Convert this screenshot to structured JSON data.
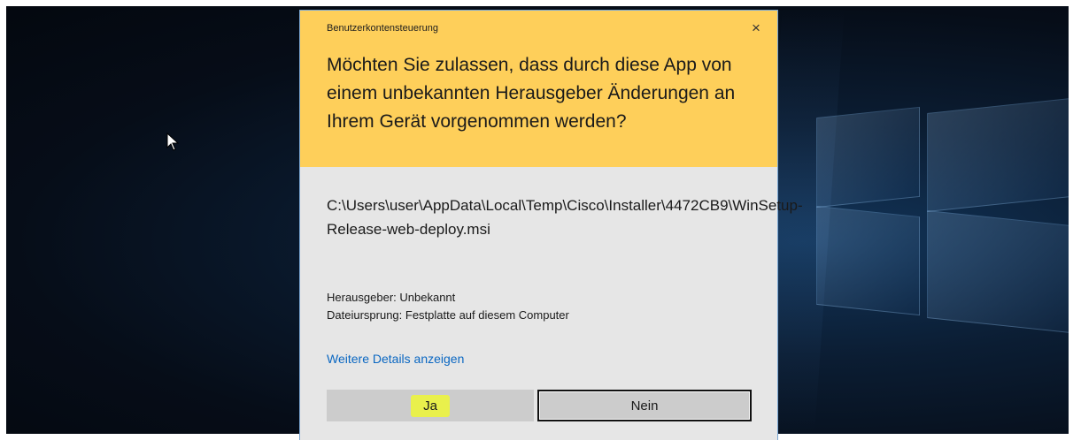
{
  "dialog": {
    "title": "Benutzerkontensteuerung",
    "close_symbol": "×",
    "question": "Möchten Sie zulassen, dass durch diese App von einem unbekannten Herausgeber Änderungen an Ihrem Gerät vorgenommen werden?",
    "program_path": "C:\\Users\\user\\AppData\\Local\\Temp\\Cisco\\Installer\\4472CB9\\WinSetup-Release-web-deploy.msi",
    "publisher": "Herausgeber: Unbekannt",
    "file_origin": "Dateiursprung: Festplatte auf diesem Computer",
    "details_link": "Weitere Details anzeigen",
    "yes_label": "Ja",
    "no_label": "Nein"
  },
  "colors": {
    "header": "#fecf5a",
    "body": "#e6e6e6",
    "link": "#0a67c2",
    "highlight": "#e9f04c"
  },
  "icons": {
    "cursor": "mouse-pointer-icon",
    "close": "close-icon",
    "desktop_logo": "windows-logo-icon"
  }
}
